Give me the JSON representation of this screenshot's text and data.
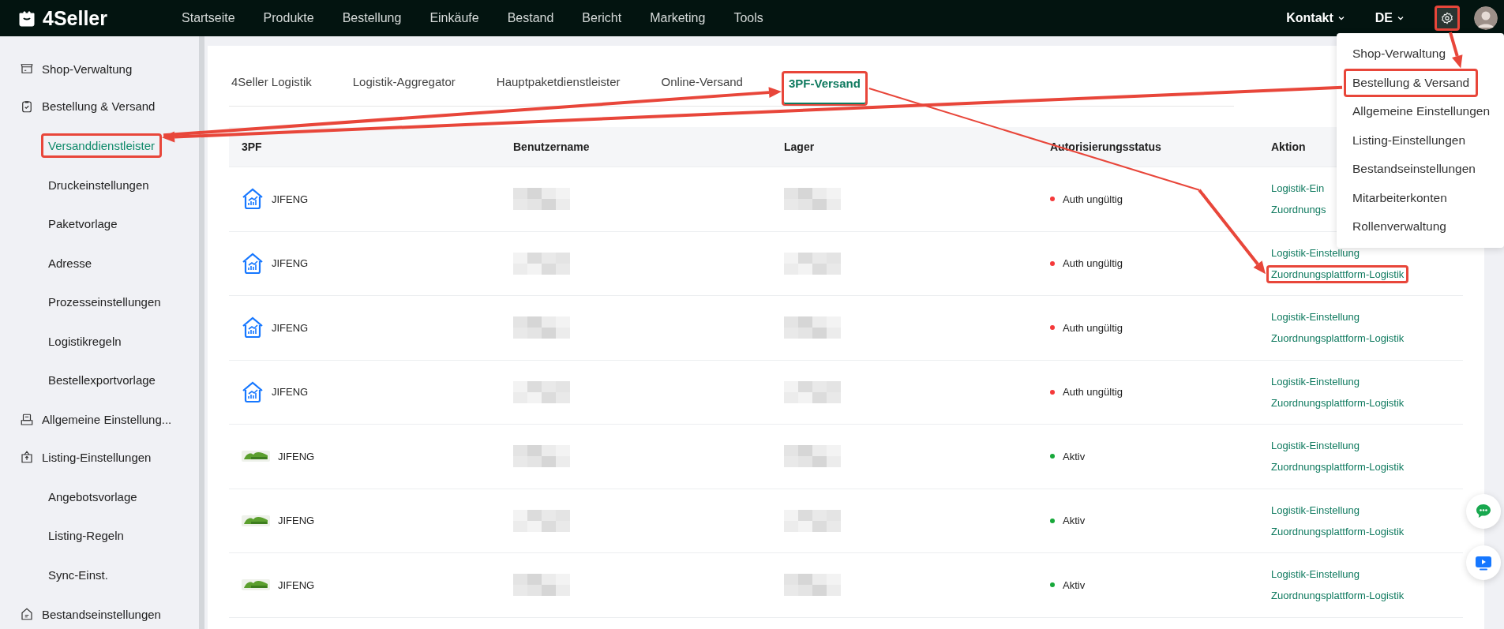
{
  "topbar": {
    "logo": "4Seller",
    "nav": [
      "Startseite",
      "Produkte",
      "Bestellung",
      "Einkäufe",
      "Bestand",
      "Bericht",
      "Marketing",
      "Tools"
    ],
    "contact": "Kontakt",
    "language": "DE",
    "settings_highlighted": true
  },
  "settings_menu": [
    {
      "label": "Shop-Verwaltung",
      "highlighted": false
    },
    {
      "label": "Bestellung & Versand",
      "highlighted": true
    },
    {
      "label": "Allgemeine Einstellungen",
      "highlighted": false
    },
    {
      "label": "Listing-Einstellungen",
      "highlighted": false
    },
    {
      "label": "Bestandseinstellungen",
      "highlighted": false
    },
    {
      "label": "Mitarbeiterkonten",
      "highlighted": false
    },
    {
      "label": "Rollenverwaltung",
      "highlighted": false
    }
  ],
  "sidebar": {
    "items": [
      {
        "label": "Shop-Verwaltung",
        "selected": false,
        "highlighted": false
      },
      {
        "label": "Bestellung & Versand",
        "selected": false,
        "highlighted": false,
        "children": [
          {
            "label": "Versanddienstleister",
            "selected": true,
            "highlighted": true
          },
          {
            "label": "Druckeinstellungen",
            "selected": false,
            "highlighted": false
          },
          {
            "label": "Paketvorlage",
            "selected": false,
            "highlighted": false
          },
          {
            "label": "Adresse",
            "selected": false,
            "highlighted": false
          },
          {
            "label": "Prozesseinstellungen",
            "selected": false,
            "highlighted": false
          },
          {
            "label": "Logistikregeln",
            "selected": false,
            "highlighted": false
          },
          {
            "label": "Bestellexportvorlage",
            "selected": false,
            "highlighted": false
          }
        ]
      },
      {
        "label": "Allgemeine Einstellung...",
        "selected": false,
        "highlighted": false
      },
      {
        "label": "Listing-Einstellungen",
        "selected": false,
        "highlighted": false,
        "children": [
          {
            "label": "Angebotsvorlage",
            "selected": false,
            "highlighted": false
          },
          {
            "label": "Listing-Regeln",
            "selected": false,
            "highlighted": false
          },
          {
            "label": "Sync-Einst.",
            "selected": false,
            "highlighted": false
          }
        ]
      },
      {
        "label": "Bestandseinstellungen",
        "selected": false,
        "highlighted": false
      }
    ]
  },
  "tabs": [
    {
      "label": "4Seller Logistik",
      "selected": false,
      "highlighted": false
    },
    {
      "label": "Logistik-Aggregator",
      "selected": false,
      "highlighted": false
    },
    {
      "label": "Hauptpaketdienstleister",
      "selected": false,
      "highlighted": false
    },
    {
      "label": "Online-Versand",
      "selected": false,
      "highlighted": false
    },
    {
      "label": "3PF-Versand",
      "selected": true,
      "highlighted": true
    }
  ],
  "table": {
    "columns": [
      "3PF",
      "Benutzername",
      "Lager",
      "Autorisierungsstatus",
      "Aktion"
    ],
    "rows": [
      {
        "kind": "house",
        "name": "JIFENG",
        "username": {
          "redacted": true
        },
        "warehouse": {
          "redacted": true
        },
        "status": {
          "label": "Auth ungültig",
          "color": "#f5393a"
        },
        "actions": [
          {
            "label": "Logistik-Ein",
            "highlighted": false
          },
          {
            "label": "Zuordnungs",
            "highlighted": false
          }
        ]
      },
      {
        "kind": "house",
        "name": "JIFENG",
        "username": {
          "redacted": true
        },
        "warehouse": {
          "redacted": true
        },
        "status": {
          "label": "Auth ungültig",
          "color": "#f5393a"
        },
        "actions": [
          {
            "label": "Logistik-Einstellung",
            "highlighted": false
          },
          {
            "label": "Zuordnungsplattform-Logistik",
            "highlighted": true
          }
        ]
      },
      {
        "kind": "house",
        "name": "JIFENG",
        "username": {
          "redacted": true
        },
        "warehouse": {
          "redacted": true
        },
        "status": {
          "label": "Auth ungültig",
          "color": "#f5393a"
        },
        "actions": [
          {
            "label": "Logistik-Einstellung",
            "highlighted": false
          },
          {
            "label": "Zuordnungsplattform-Logistik",
            "highlighted": false
          }
        ]
      },
      {
        "kind": "house",
        "name": "JIFENG",
        "username": {
          "redacted": true
        },
        "warehouse": {
          "redacted": true
        },
        "status": {
          "label": "Auth ungültig",
          "color": "#f5393a"
        },
        "actions": [
          {
            "label": "Logistik-Einstellung",
            "highlighted": false
          },
          {
            "label": "Zuordnungsplattform-Logistik",
            "highlighted": false
          }
        ]
      },
      {
        "kind": "leaf",
        "name": "JIFENG",
        "username": {
          "redacted": true
        },
        "warehouse": {
          "redacted": true
        },
        "status": {
          "label": "Aktiv",
          "color": "#17a83a"
        },
        "actions": [
          {
            "label": "Logistik-Einstellung",
            "highlighted": false
          },
          {
            "label": "Zuordnungsplattform-Logistik",
            "highlighted": false
          }
        ]
      },
      {
        "kind": "leaf",
        "name": "JIFENG",
        "username": {
          "redacted": true
        },
        "warehouse": {
          "redacted": true
        },
        "status": {
          "label": "Aktiv",
          "color": "#17a83a"
        },
        "actions": [
          {
            "label": "Logistik-Einstellung",
            "highlighted": false
          },
          {
            "label": "Zuordnungsplattform-Logistik",
            "highlighted": false
          }
        ]
      },
      {
        "kind": "leaf",
        "name": "JIFENG",
        "username": {
          "redacted": true
        },
        "warehouse": {
          "redacted": true
        },
        "status": {
          "label": "Aktiv",
          "color": "#17a83a"
        },
        "actions": [
          {
            "label": "Logistik-Einstellung",
            "highlighted": false
          },
          {
            "label": "Zuordnungsplattform-Logistik",
            "highlighted": false
          }
        ]
      }
    ]
  }
}
